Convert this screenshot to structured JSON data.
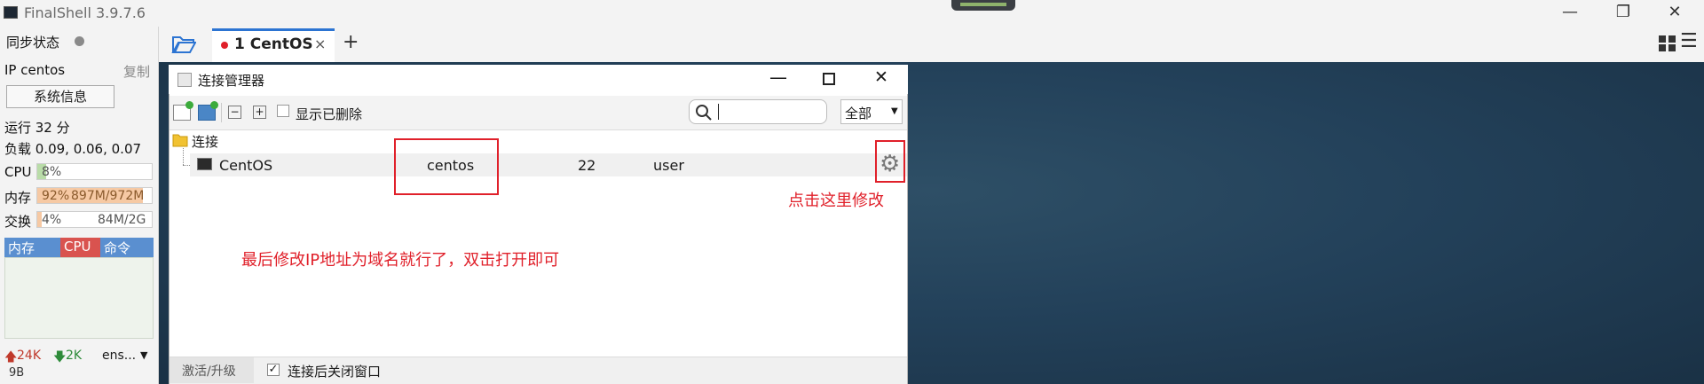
{
  "window": {
    "title": "FinalShell 3.9.7.6"
  },
  "sidebar": {
    "sync_label": "同步状态",
    "ip_label": "IP centos",
    "copy_label": "复制",
    "sysinfo_button": "系统信息",
    "uptime": "运行 32 分",
    "load": "负载 0.09, 0.06, 0.07",
    "cpu": {
      "label": "CPU",
      "value": "8%",
      "percent": 8
    },
    "mem": {
      "label": "内存",
      "percent_text": "92%",
      "value": "897M/972M",
      "percent": 92
    },
    "swap": {
      "label": "交换",
      "percent_text": "4%",
      "value": "84M/2G",
      "percent": 4
    },
    "proc_tabs": [
      "内存",
      "CPU",
      "命令"
    ],
    "net": {
      "up": "24K",
      "down": "2K",
      "iface": "ens...",
      "bottom": "9B"
    },
    "colors": {
      "mem_fill": "#f6c9a4",
      "cpu_fill": "#b9dca8",
      "tab_cpu": "#d9534f",
      "tab_bg": "#5a8fd0"
    }
  },
  "tabs": [
    {
      "label": "1 CentOS",
      "status_color": "#e0202a"
    }
  ],
  "dialog": {
    "title": "连接管理器",
    "toolbar": {
      "show_deleted": "显示已删除",
      "filter_value": "全部"
    },
    "tree": {
      "folder": "连接",
      "rows": [
        {
          "name": "CentOS",
          "host": "centos",
          "port": "22",
          "user": "user"
        }
      ]
    },
    "annotations": {
      "modify_hint": "点击这里修改",
      "final_hint": "最后修改IP地址为域名就行了，双击打开即可"
    },
    "bottom": {
      "activate": "激活/升级",
      "close_after": "连接后关闭窗口"
    }
  }
}
